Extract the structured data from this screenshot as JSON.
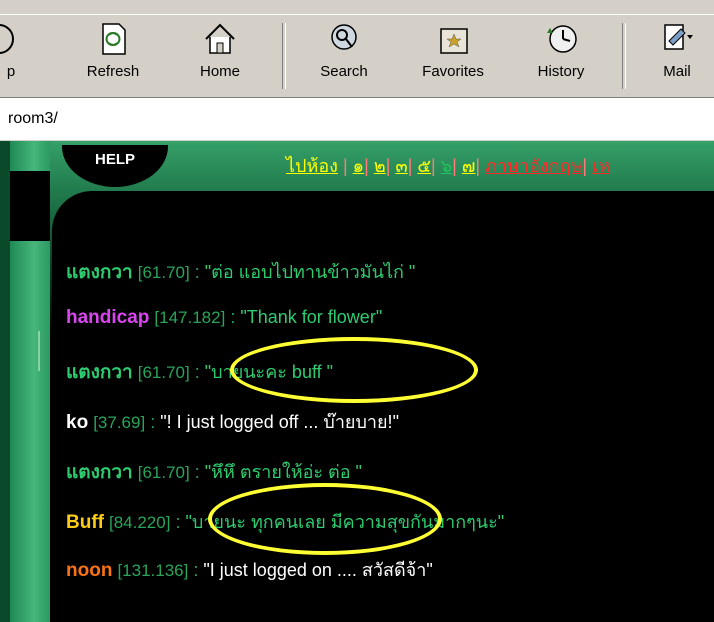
{
  "toolbar": {
    "buttons": [
      {
        "label": "p",
        "icon": "stop-icon"
      },
      {
        "label": "Refresh",
        "icon": "refresh-icon"
      },
      {
        "label": "Home",
        "icon": "home-icon"
      },
      {
        "label": "Search",
        "icon": "search-icon"
      },
      {
        "label": "Favorites",
        "icon": "favorites-icon"
      },
      {
        "label": "History",
        "icon": "history-icon"
      },
      {
        "label": "Mail",
        "icon": "mail-icon"
      }
    ]
  },
  "address": {
    "value": "room3/"
  },
  "page": {
    "help_label": "HELP",
    "room_nav": {
      "prefix": "ไปห้อง",
      "rooms": [
        "๑",
        "๒",
        "๓",
        "๕",
        "๖",
        "๗",
        "ภาษาอังกฤษ",
        "เห"
      ]
    },
    "messages": [
      {
        "nick": "แตงกวา",
        "nick_color": "#2ecc71",
        "ip": "[61.70]",
        "text": "\"ต่อ แอบไปทานข้าวมันไก่ \"",
        "text_color": "#2ecc71"
      },
      {
        "nick": "handicap",
        "nick_color": "#d946ef",
        "ip": "[147.182]",
        "text": "\"Thank for flower\"",
        "text_color": "#2ecc71"
      },
      {
        "nick": "แตงกวา",
        "nick_color": "#2ecc71",
        "ip": "[61.70]",
        "text": "\"บายนะคะ buff \"",
        "text_color": "#2ecc71"
      },
      {
        "nick": "ko",
        "nick_color": "#ffffff",
        "ip": "[37.69]",
        "text": "\"! I just logged off ... บ๊ายบาย!\"",
        "text_color": "#ffffff"
      },
      {
        "nick": "แตงกวา",
        "nick_color": "#2ecc71",
        "ip": "[61.70]",
        "text": "\"หึหึ ตรายให้อ่ะ ต่อ \"",
        "text_color": "#2ecc71"
      },
      {
        "nick": "Buff",
        "nick_color": "#facc15",
        "ip": "[84.220]",
        "text": "\"บายนะ ทุกคนเลย มีความสุขกันมากๆนะ\"",
        "text_color": "#2ecc71"
      },
      {
        "nick": "noon",
        "nick_color": "#f97316",
        "ip": "[131.136]",
        "text": "\"I just logged on .... สวัสดีจ้า\"",
        "text_color": "#ffffff"
      }
    ]
  },
  "colors": {
    "highlight_ring": "#ffff33"
  }
}
